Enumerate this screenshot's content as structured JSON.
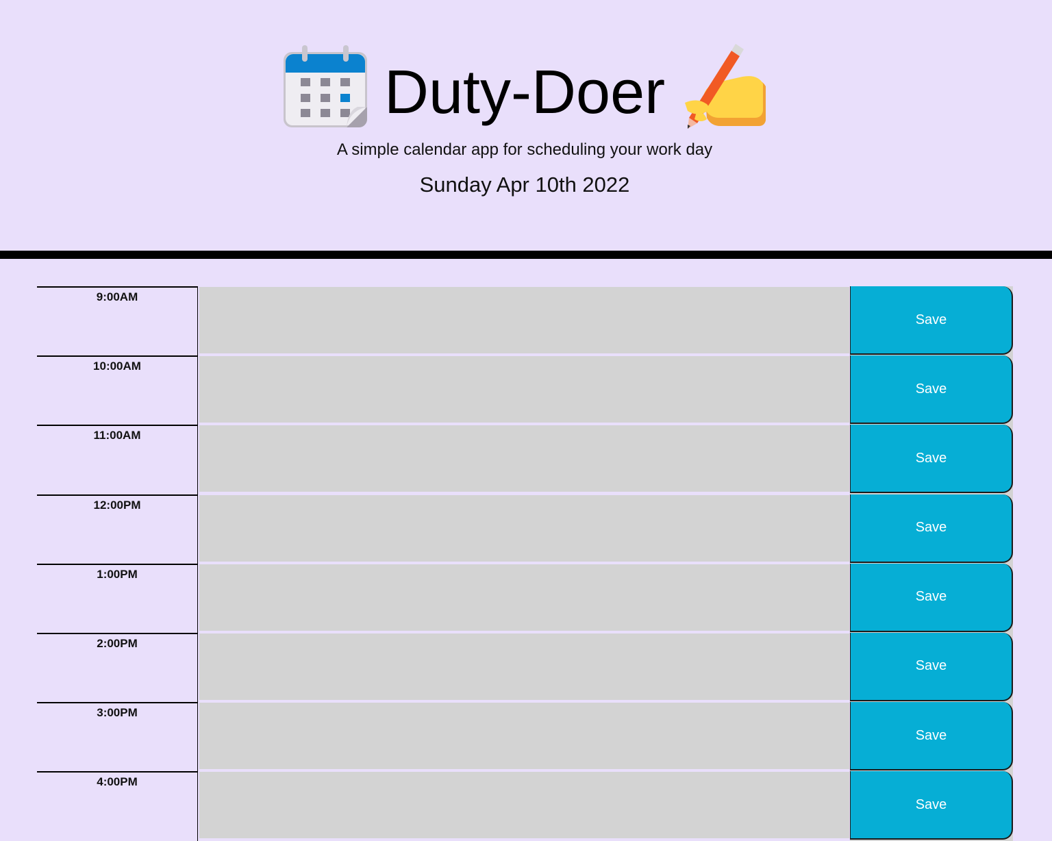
{
  "header": {
    "title": "Duty-Doer",
    "subtitle": "A simple calendar app for scheduling your work day",
    "current_date": "Sunday Apr 10th 2022",
    "icons": [
      "calendar-icon",
      "writing-hand-icon"
    ]
  },
  "planner": {
    "rows": [
      {
        "hour": "9:00AM",
        "task": "",
        "save_label": "Save"
      },
      {
        "hour": "10:00AM",
        "task": "",
        "save_label": "Save"
      },
      {
        "hour": "11:00AM",
        "task": "",
        "save_label": "Save"
      },
      {
        "hour": "12:00PM",
        "task": "",
        "save_label": "Save"
      },
      {
        "hour": "1:00PM",
        "task": "",
        "save_label": "Save"
      },
      {
        "hour": "2:00PM",
        "task": "",
        "save_label": "Save"
      },
      {
        "hour": "3:00PM",
        "task": "",
        "save_label": "Save"
      },
      {
        "hour": "4:00PM",
        "task": "",
        "save_label": "Save"
      }
    ]
  },
  "colors": {
    "background": "#e9dffb",
    "textarea": "#d3d3d3",
    "save_button": "#06aed5",
    "divider": "#000000"
  }
}
